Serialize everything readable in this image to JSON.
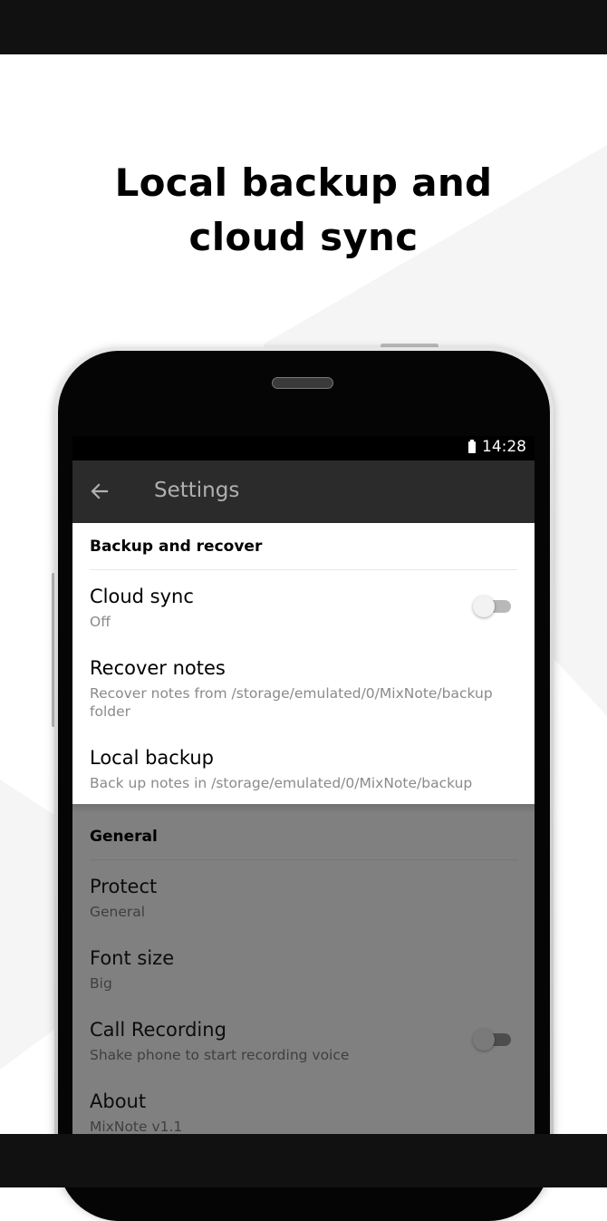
{
  "promo": {
    "headline_line1": "Local backup and",
    "headline_line2": "cloud sync"
  },
  "status_bar": {
    "time": "14:28",
    "battery_icon": "battery-full-icon"
  },
  "app_bar": {
    "back_icon": "arrow-left-icon",
    "title": "Settings"
  },
  "sections": {
    "backup": {
      "header": "Backup and recover",
      "items": [
        {
          "title": "Cloud sync",
          "summary": "Off",
          "toggle_on": false
        },
        {
          "title": "Recover notes",
          "summary": "Recover notes from /storage/emulated/0/MixNote/backup folder"
        },
        {
          "title": "Local backup",
          "summary": "Back up notes in /storage/emulated/0/MixNote/backup"
        }
      ]
    },
    "general": {
      "header": "General",
      "items": [
        {
          "title": "Protect",
          "summary": "General"
        },
        {
          "title": "Font size",
          "summary": "Big"
        },
        {
          "title": "Call Recording",
          "summary": "Shake phone to start recording voice",
          "toggle_on": false
        },
        {
          "title": "About",
          "summary": "MixNote v1.1"
        }
      ]
    }
  },
  "colors": {
    "app_bar": "#2b2b2b",
    "dim_overlay": "#808080",
    "highlight_card": "#ffffff",
    "frame_bars": "#111111"
  }
}
